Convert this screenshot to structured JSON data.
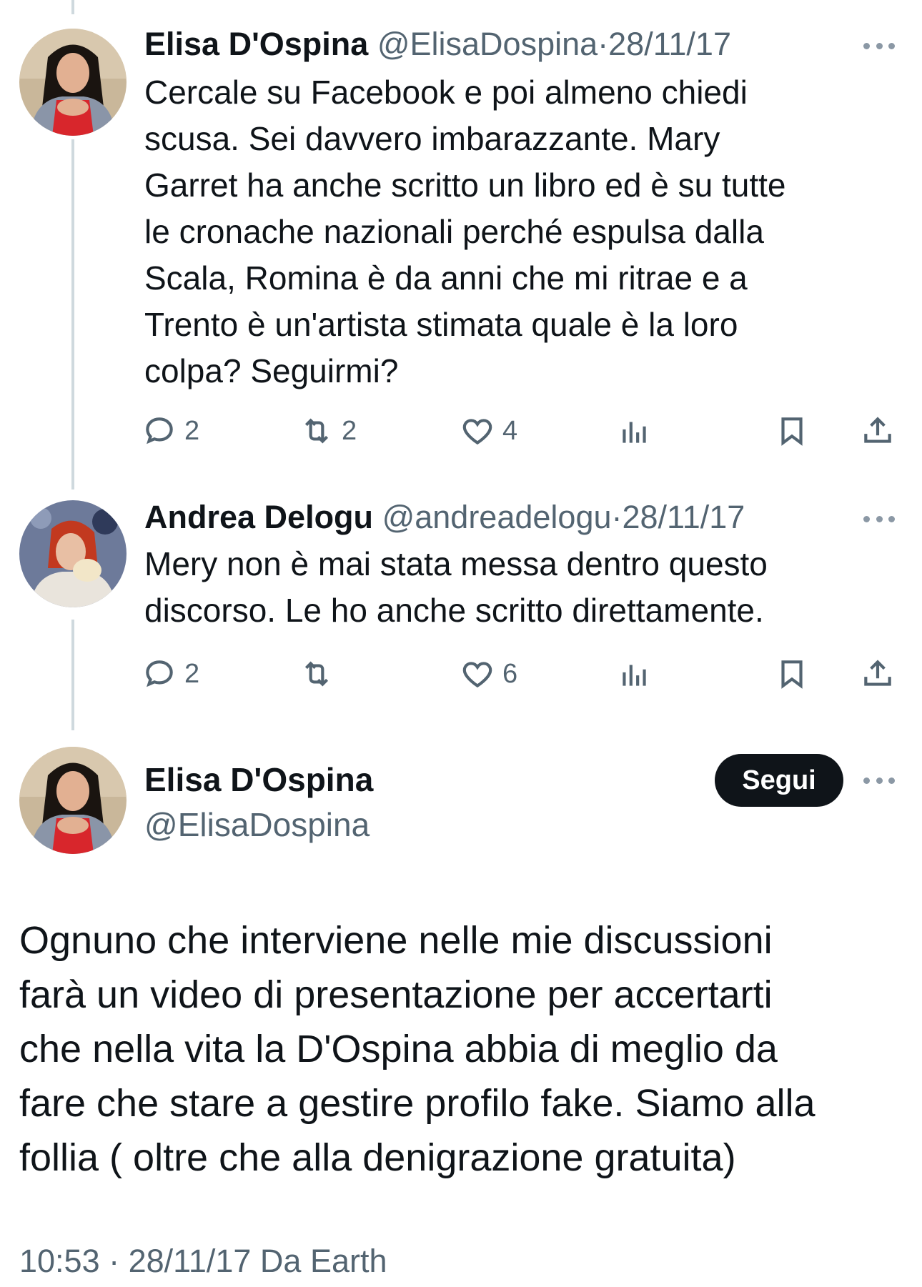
{
  "tweets": [
    {
      "name": "Elisa D'Ospina",
      "handle": "@ElisaDospina",
      "separator": "·",
      "date": "28/11/17",
      "text_lines": [
        "Cercale su Facebook e poi almeno chiedi",
        "scusa. Sei davvero imbarazzante. Mary",
        "Garret ha anche scritto un libro ed è su tutte",
        "le cronache nazionali perché espulsa dalla",
        "Scala, Romina è da anni che mi ritrae e a",
        "Trento è un'artista stimata quale è la loro",
        "colpa? Seguirmi?"
      ],
      "replies": "2",
      "retweets": "2",
      "likes": "4"
    },
    {
      "name": "Andrea Delogu",
      "handle": "@andreadelogu",
      "separator": "·",
      "date": "28/11/17",
      "text_lines": [
        "Mery non è mai stata messa dentro questo",
        "discorso. Le ho anche scritto direttamente."
      ],
      "replies": "2",
      "retweets": "",
      "likes": "6"
    }
  ],
  "main_tweet": {
    "name": "Elisa D'Ospina",
    "handle": "@ElisaDospina",
    "follow_label": "Segui",
    "text_lines": [
      "Ognuno che interviene nelle mie discussioni",
      "farà un video di presentazione per accertarti",
      "che nella vita la D'Ospina abbia di meglio da",
      "fare che stare a gestire profilo fake. Siamo alla",
      "follia ( oltre che alla denigrazione gratuita)"
    ],
    "meta": "10:53 · 28/11/17 Da Earth"
  },
  "icons": [
    "reply-icon",
    "retweet-icon",
    "like-icon",
    "views-icon",
    "bookmark-icon",
    "share-icon",
    "more-icon"
  ],
  "colors": {
    "text": "#0f1419",
    "secondary": "#536471",
    "thread_line": "#cfd9de",
    "button_bg": "#0f1419"
  }
}
